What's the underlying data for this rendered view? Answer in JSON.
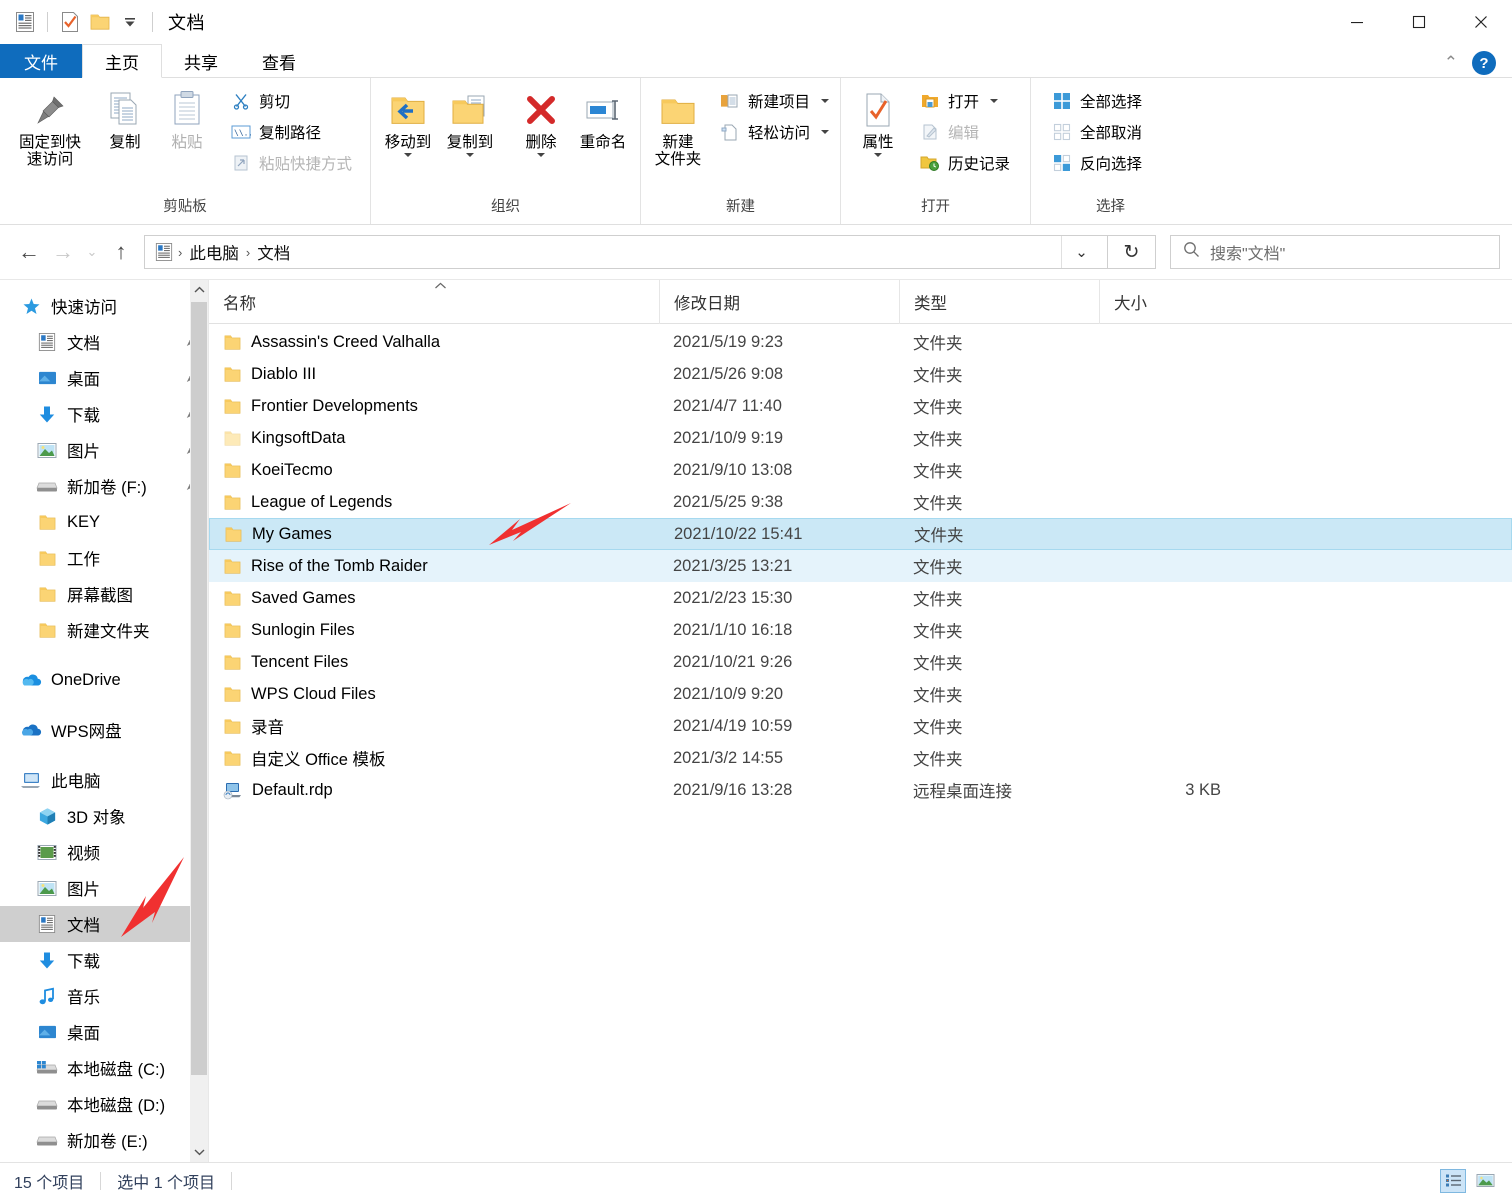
{
  "window": {
    "title": "文档",
    "qat": [
      {
        "name": "documents-folder-icon",
        "label": "文档"
      },
      {
        "name": "properties-check-icon",
        "label": "属性"
      },
      {
        "name": "new-folder-icon",
        "label": "新建文件夹"
      }
    ],
    "controls": {
      "minimize": "—",
      "maximize": "□",
      "close": "✕"
    }
  },
  "tabs": [
    {
      "id": "file",
      "label": "文件"
    },
    {
      "id": "home",
      "label": "主页"
    },
    {
      "id": "share",
      "label": "共享"
    },
    {
      "id": "view",
      "label": "查看"
    }
  ],
  "tab_right": {
    "collapse": "⌃",
    "help": "?"
  },
  "ribbon": {
    "groups": [
      {
        "id": "clipboard",
        "label": "剪贴板",
        "big": [
          {
            "name": "pin-to-quick-access",
            "label": "固定到快\n速访问",
            "icon": "pin-icon",
            "disabled": false
          },
          {
            "name": "copy",
            "label": "复制",
            "icon": "copy-icon",
            "disabled": false
          },
          {
            "name": "paste",
            "label": "粘贴",
            "icon": "paste-icon",
            "disabled": true
          }
        ],
        "small": [
          {
            "name": "cut",
            "label": "剪切",
            "icon": "scissors-icon",
            "disabled": false
          },
          {
            "name": "copy-path",
            "label": "复制路径",
            "icon": "copy-path-icon",
            "disabled": false
          },
          {
            "name": "paste-shortcut",
            "label": "粘贴快捷方式",
            "icon": "paste-shortcut-icon",
            "disabled": true
          }
        ]
      },
      {
        "id": "organize",
        "label": "组织",
        "big": [
          {
            "name": "move-to",
            "label": "移动到",
            "icon": "move-to-icon",
            "caret": true
          },
          {
            "name": "copy-to",
            "label": "复制到",
            "icon": "copy-to-icon",
            "caret": true
          },
          {
            "name": "delete",
            "label": "删除",
            "icon": "delete-icon",
            "caret": true
          },
          {
            "name": "rename",
            "label": "重命名",
            "icon": "rename-icon",
            "caret": false
          }
        ]
      },
      {
        "id": "new",
        "label": "新建",
        "big": [
          {
            "name": "new-folder",
            "label": "新建\n文件夹",
            "icon": "folder-icon"
          }
        ],
        "small": [
          {
            "name": "new-item",
            "label": "新建项目",
            "icon": "new-item-icon",
            "caret": true
          },
          {
            "name": "easy-access",
            "label": "轻松访问",
            "icon": "easy-access-icon",
            "caret": true
          }
        ]
      },
      {
        "id": "open",
        "label": "打开",
        "big": [
          {
            "name": "properties",
            "label": "属性",
            "icon": "properties-icon",
            "caret": true
          }
        ],
        "small": [
          {
            "name": "open",
            "label": "打开",
            "icon": "open-icon",
            "caret": true,
            "disabled": false
          },
          {
            "name": "edit",
            "label": "编辑",
            "icon": "edit-icon",
            "disabled": true
          },
          {
            "name": "history",
            "label": "历史记录",
            "icon": "history-icon",
            "disabled": false
          }
        ]
      },
      {
        "id": "select",
        "label": "选择",
        "small": [
          {
            "name": "select-all",
            "label": "全部选择",
            "icon": "select-all-icon"
          },
          {
            "name": "select-none",
            "label": "全部取消",
            "icon": "select-none-icon"
          },
          {
            "name": "invert-selection",
            "label": "反向选择",
            "icon": "invert-selection-icon"
          }
        ]
      }
    ]
  },
  "addressbar": {
    "back": "←",
    "forward": "→",
    "recent": "⌄",
    "up": "↑",
    "crumbs": [
      "此电脑",
      "文档"
    ],
    "sep": "›",
    "dropdown": "⌄",
    "refresh": "↻",
    "search_placeholder": "搜索\"文档\""
  },
  "sidebar": {
    "sections": [
      {
        "header": {
          "name": "quick-access",
          "label": "快速访问",
          "icon": "star-icon"
        },
        "items": [
          {
            "label": "文档",
            "icon": "documents-icon",
            "pinned": true
          },
          {
            "label": "桌面",
            "icon": "desktop-icon",
            "pinned": true
          },
          {
            "label": "下载",
            "icon": "downloads-icon",
            "pinned": true
          },
          {
            "label": "图片",
            "icon": "pictures-icon",
            "pinned": true
          },
          {
            "label": "新加卷 (F:)",
            "icon": "drive-icon",
            "pinned": true
          },
          {
            "label": "KEY",
            "icon": "folder-icon",
            "pinned": false
          },
          {
            "label": "工作",
            "icon": "folder-icon",
            "pinned": false
          },
          {
            "label": "屏幕截图",
            "icon": "folder-icon",
            "pinned": false
          },
          {
            "label": "新建文件夹",
            "icon": "folder-icon",
            "pinned": false
          }
        ]
      },
      {
        "header": {
          "name": "onedrive",
          "label": "OneDrive",
          "icon": "onedrive-icon"
        },
        "items": []
      },
      {
        "header": {
          "name": "wps-cloud",
          "label": "WPS网盘",
          "icon": "wps-cloud-icon"
        },
        "items": []
      },
      {
        "header": {
          "name": "this-pc",
          "label": "此电脑",
          "icon": "this-pc-icon"
        },
        "items": [
          {
            "label": "3D 对象",
            "icon": "3d-objects-icon",
            "selected": false
          },
          {
            "label": "视频",
            "icon": "videos-icon",
            "selected": false
          },
          {
            "label": "图片",
            "icon": "pictures-icon",
            "selected": false
          },
          {
            "label": "文档",
            "icon": "documents-icon",
            "selected": true
          },
          {
            "label": "下载",
            "icon": "downloads-icon",
            "selected": false
          },
          {
            "label": "音乐",
            "icon": "music-icon",
            "selected": false
          },
          {
            "label": "桌面",
            "icon": "desktop-icon",
            "selected": false
          },
          {
            "label": "本地磁盘 (C:)",
            "icon": "windows-drive-icon",
            "selected": false
          },
          {
            "label": "本地磁盘 (D:)",
            "icon": "drive-icon",
            "selected": false
          },
          {
            "label": "新加卷 (E:)",
            "icon": "drive-icon",
            "selected": false
          }
        ]
      }
    ]
  },
  "filelist": {
    "columns": [
      {
        "key": "name",
        "label": "名称",
        "sorted": true,
        "sortmark": "⌃"
      },
      {
        "key": "date",
        "label": "修改日期"
      },
      {
        "key": "type",
        "label": "类型"
      },
      {
        "key": "size",
        "label": "大小"
      }
    ],
    "rows": [
      {
        "name": "Assassin's Creed Valhalla",
        "date": "2021/5/19 9:23",
        "type": "文件夹",
        "size": "",
        "icon": "folder-icon",
        "state": "none"
      },
      {
        "name": "Diablo III",
        "date": "2021/5/26 9:08",
        "type": "文件夹",
        "size": "",
        "icon": "folder-icon",
        "state": "none"
      },
      {
        "name": "Frontier Developments",
        "date": "2021/4/7 11:40",
        "type": "文件夹",
        "size": "",
        "icon": "folder-icon",
        "state": "none"
      },
      {
        "name": "KingsoftData",
        "date": "2021/10/9 9:19",
        "type": "文件夹",
        "size": "",
        "icon": "folder-faded-icon",
        "state": "none"
      },
      {
        "name": "KoeiTecmo",
        "date": "2021/9/10 13:08",
        "type": "文件夹",
        "size": "",
        "icon": "folder-icon",
        "state": "none"
      },
      {
        "name": "League of Legends",
        "date": "2021/5/25 9:38",
        "type": "文件夹",
        "size": "",
        "icon": "folder-icon",
        "state": "none"
      },
      {
        "name": "My Games",
        "date": "2021/10/22 15:41",
        "type": "文件夹",
        "size": "",
        "icon": "folder-icon",
        "state": "selected"
      },
      {
        "name": "Rise of the Tomb Raider",
        "date": "2021/3/25 13:21",
        "type": "文件夹",
        "size": "",
        "icon": "folder-icon",
        "state": "highlight"
      },
      {
        "name": "Saved Games",
        "date": "2021/2/23 15:30",
        "type": "文件夹",
        "size": "",
        "icon": "folder-icon",
        "state": "none"
      },
      {
        "name": "Sunlogin Files",
        "date": "2021/1/10 16:18",
        "type": "文件夹",
        "size": "",
        "icon": "folder-icon",
        "state": "none"
      },
      {
        "name": "Tencent Files",
        "date": "2021/10/21 9:26",
        "type": "文件夹",
        "size": "",
        "icon": "folder-icon",
        "state": "none"
      },
      {
        "name": "WPS Cloud Files",
        "date": "2021/10/9 9:20",
        "type": "文件夹",
        "size": "",
        "icon": "folder-icon",
        "state": "none"
      },
      {
        "name": "录音",
        "date": "2021/4/19 10:59",
        "type": "文件夹",
        "size": "",
        "icon": "folder-icon",
        "state": "none"
      },
      {
        "name": "自定义 Office 模板",
        "date": "2021/3/2 14:55",
        "type": "文件夹",
        "size": "",
        "icon": "folder-icon",
        "state": "none"
      },
      {
        "name": "Default.rdp",
        "date": "2021/9/16 13:28",
        "type": "远程桌面连接",
        "size": "3 KB",
        "icon": "rdp-icon",
        "state": "none"
      }
    ]
  },
  "status": {
    "item_count": "15 个项目",
    "selection": "选中 1 个项目",
    "views": [
      {
        "name": "details-view",
        "active": true
      },
      {
        "name": "large-icons-view",
        "active": false
      }
    ]
  },
  "annotations": {
    "arrow_color": "#f03030",
    "arrows": [
      {
        "name": "arrow-pointing-my-games"
      },
      {
        "name": "arrow-pointing-sidebar-documents"
      }
    ]
  },
  "colors": {
    "accent": "#0f6cbd",
    "selection": "#cbe8f6",
    "selection_light": "#e5f3fb",
    "folder": "#fbd474"
  }
}
